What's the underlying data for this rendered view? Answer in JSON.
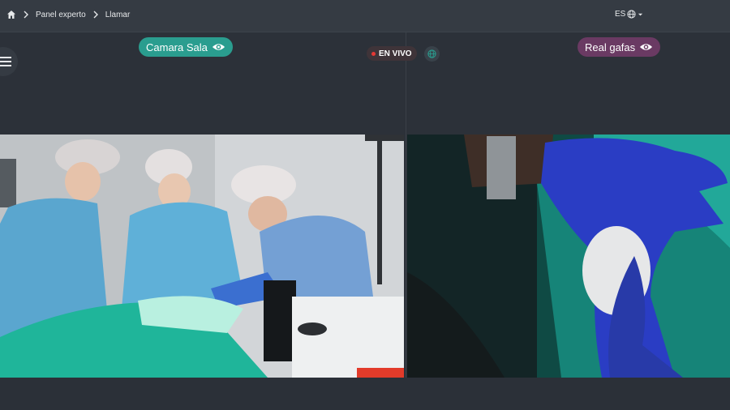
{
  "breadcrumb": {
    "items": [
      {
        "label": "Panel experto"
      },
      {
        "label": "Llamar"
      }
    ]
  },
  "language": {
    "code": "ES"
  },
  "streams": {
    "room": {
      "label": "Camara Sala"
    },
    "glasses": {
      "label": "Real gafas"
    },
    "live_label": "EN VIVO"
  },
  "colors": {
    "room_pill": "#2a9d8f",
    "glasses_pill": "#6a3a63",
    "live_dot": "#e53935"
  }
}
